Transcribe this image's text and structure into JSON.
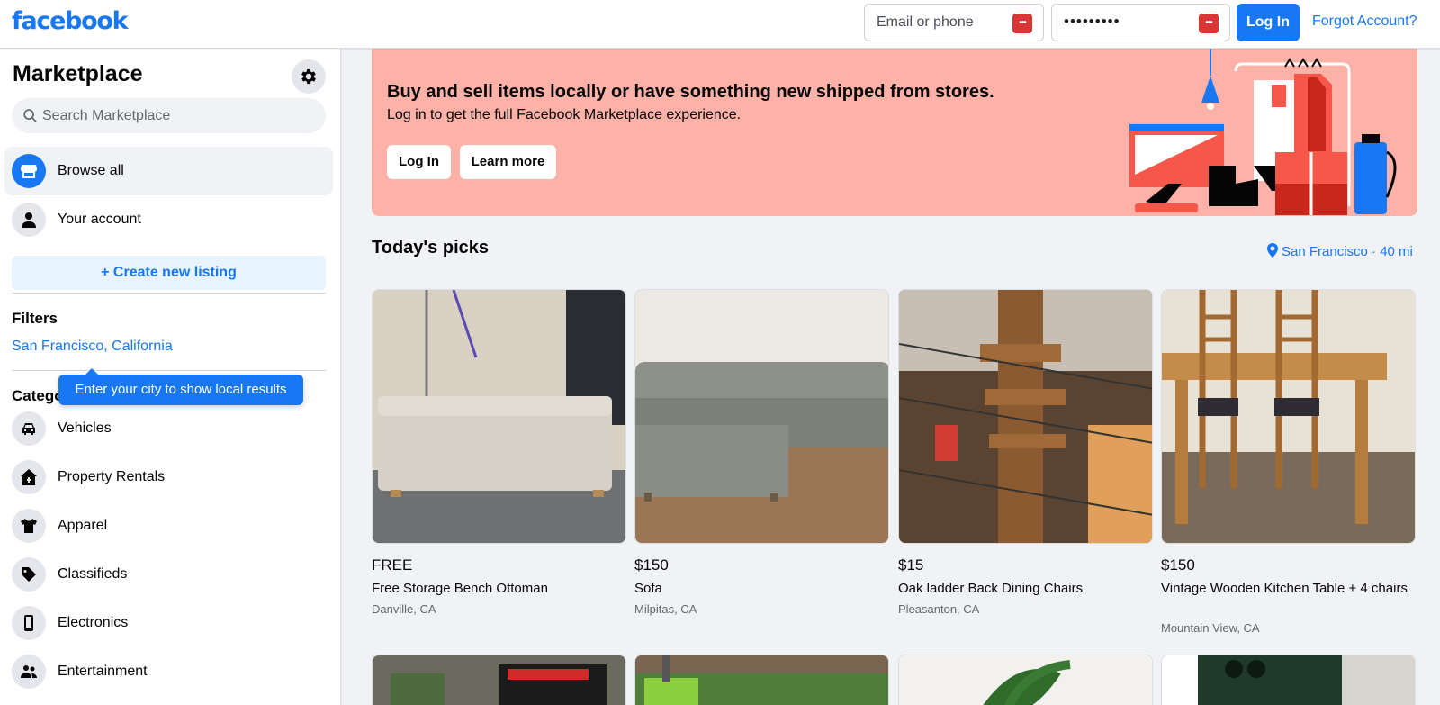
{
  "header": {
    "logo": "facebook",
    "email_placeholder": "Email or phone",
    "password_mask": "•••••••••",
    "login_label": "Log In",
    "forgot_label": "Forgot Account?"
  },
  "sidebar": {
    "title": "Marketplace",
    "search_placeholder": "Search Marketplace",
    "nav": [
      {
        "label": "Browse all",
        "icon": "storefront-icon",
        "active": true
      },
      {
        "label": "Your account",
        "icon": "person-icon",
        "active": false
      }
    ],
    "create_label": "+ Create new listing",
    "filters_heading": "Filters",
    "location_filter": "San Francisco, California",
    "tooltip": "Enter your city to show local results",
    "categories_heading": "Categories",
    "categories": [
      {
        "label": "Vehicles",
        "icon": "car-icon"
      },
      {
        "label": "Property Rentals",
        "icon": "house-icon"
      },
      {
        "label": "Apparel",
        "icon": "shirt-icon"
      },
      {
        "label": "Classifieds",
        "icon": "tag-icon"
      },
      {
        "label": "Electronics",
        "icon": "phone-icon"
      },
      {
        "label": "Entertainment",
        "icon": "people-icon"
      }
    ]
  },
  "banner": {
    "heading": "Buy and sell items locally or have something new shipped from stores.",
    "subtext": "Log in to get the full Facebook Marketplace experience.",
    "login_label": "Log In",
    "learn_more_label": "Learn more"
  },
  "picks": {
    "heading": "Today's picks",
    "location": "San Francisco · 40 mi",
    "listings": [
      {
        "price": "FREE",
        "title": "Free Storage Bench Ottoman",
        "city": "Danville, CA"
      },
      {
        "price": "$150",
        "title": "Sofa",
        "city": "Milpitas, CA"
      },
      {
        "price": "$15",
        "title": "Oak ladder Back Dining Chairs",
        "city": "Pleasanton, CA"
      },
      {
        "price": "$150",
        "title": "Vintage Wooden Kitchen Table + 4 chairs",
        "city": "Mountain View, CA"
      }
    ]
  },
  "colors": {
    "brand": "#1877f2",
    "banner_bg": "#feb2a7",
    "page_bg": "#f0f2f5"
  }
}
